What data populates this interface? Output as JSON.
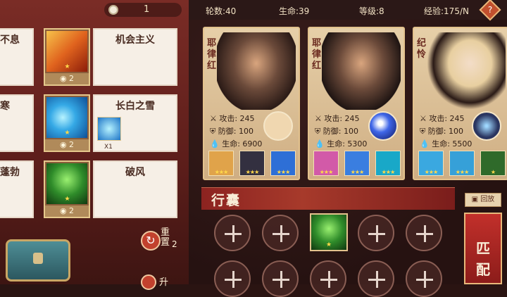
{
  "topbar": {
    "coins": "1"
  },
  "stats": {
    "rounds": "轮数:40",
    "hp": "生命:39",
    "level": "等级:8",
    "exp": "经验:175/N",
    "help": "?"
  },
  "shop": [
    {
      "left_label": "不息",
      "title": "机会主义",
      "cost": "2",
      "colors": [
        "#f29a2e",
        "#c23a0e"
      ]
    },
    {
      "left_label": "寒",
      "title": "长白之雪",
      "cost": "2",
      "colors": [
        "#6fd2ee",
        "#1b73c6"
      ],
      "extra_count": "X1"
    },
    {
      "left_label": "蓬勃",
      "title": "破风",
      "cost": "2",
      "colors": [
        "#6bc93d",
        "#1e5a1a"
      ]
    }
  ],
  "actions": {
    "reset_label": "重置",
    "reset_cost": "2",
    "upgrade_label": "升"
  },
  "heroes": [
    {
      "name": "耶律红",
      "atk": "攻击: 245",
      "def": "防御: 100",
      "hp": "生命: 6900",
      "skill_color": "#f0d7b0",
      "equips": [
        "#e0a34a",
        "#333040",
        "#2e6fd6"
      ]
    },
    {
      "name": "耶律红",
      "atk": "攻击: 245",
      "def": "防御: 100",
      "hp": "生命: 5300",
      "skill_color": "#2040c0",
      "equips": [
        "#d25aa8",
        "#3a7ee0",
        "#19a8c8"
      ]
    },
    {
      "name": "纪怜",
      "atk": "攻击: 245",
      "def": "防御: 100",
      "hp": "生命: 5500",
      "skill_color": "#2a3560",
      "equips": [
        "#3aa8e0",
        "#36a0d8",
        "#2f6a2a"
      ]
    }
  ],
  "bag": {
    "title": "行囊",
    "replay": "回放",
    "match": "匹配"
  }
}
